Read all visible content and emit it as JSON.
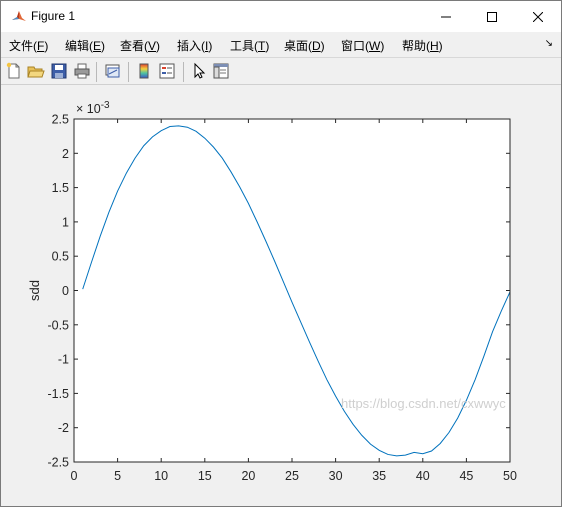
{
  "window": {
    "title": "Figure 1",
    "controls": {
      "minimize": "—",
      "maximize": "☐",
      "close": "✕"
    }
  },
  "menubar": {
    "items": [
      {
        "label": "文件(",
        "key": "F",
        "end": ")"
      },
      {
        "label": "编辑(",
        "key": "E",
        "end": ")"
      },
      {
        "label": "查看(",
        "key": "V",
        "end": ")"
      },
      {
        "label": "插入(",
        "key": "I",
        "end": ")"
      },
      {
        "label": "工具(",
        "key": "T",
        "end": ")"
      },
      {
        "label": "桌面(",
        "key": "D",
        "end": ")"
      },
      {
        "label": "窗口(",
        "key": "W",
        "end": ")"
      },
      {
        "label": "帮助(",
        "key": "H",
        "end": ")"
      }
    ],
    "overflow_icon": "↘"
  },
  "toolbar": {
    "icons": [
      "new-figure-icon",
      "open-icon",
      "save-icon",
      "print-icon",
      "link-plot-icon",
      "colorbar-icon",
      "legend-icon",
      "pointer-icon",
      "property-editor-icon"
    ]
  },
  "watermark": "https://blog.csdn.net/cxwwyc",
  "chart_data": {
    "type": "line",
    "xlabel": "",
    "ylabel": "sdd",
    "exponent_label": "× 10",
    "exponent_power": "-3",
    "xlim": [
      0,
      50
    ],
    "ylim": [
      -2.5,
      2.5
    ],
    "xticks": [
      0,
      5,
      10,
      15,
      20,
      25,
      30,
      35,
      40,
      45,
      50
    ],
    "xtick_labels": [
      "0",
      "5",
      "10",
      "15",
      "20",
      "25",
      "30",
      "35",
      "40",
      "45",
      "50"
    ],
    "yticks": [
      2.5,
      2,
      1.5,
      1,
      0.5,
      0,
      -0.5,
      -1,
      -1.5,
      -2,
      -2.5
    ],
    "ytick_labels": [
      "2.5",
      "2",
      "1.5",
      "1",
      "0.5",
      "0",
      "-0.5",
      "-1",
      "-1.5",
      "-2",
      "-2.5"
    ],
    "grid": false,
    "series": [
      {
        "color": "#0072bd",
        "x": [
          1,
          2,
          3,
          4,
          5,
          6,
          7,
          8,
          9,
          10,
          11,
          12,
          13,
          14,
          15,
          16,
          17,
          18,
          19,
          20,
          21,
          22,
          23,
          24,
          25,
          26,
          27,
          28,
          29,
          30,
          31,
          32,
          33,
          34,
          35,
          36,
          37,
          38,
          39,
          40,
          41,
          42,
          43,
          44,
          45,
          46,
          47,
          48,
          49,
          50
        ],
        "y": [
          0.02,
          0.41,
          0.79,
          1.14,
          1.45,
          1.71,
          1.93,
          2.11,
          2.24,
          2.33,
          2.39,
          2.4,
          2.38,
          2.32,
          2.22,
          2.09,
          1.93,
          1.73,
          1.51,
          1.27,
          1.0,
          0.72,
          0.43,
          0.13,
          -0.17,
          -0.46,
          -0.75,
          -1.03,
          -1.3,
          -1.54,
          -1.76,
          -1.95,
          -2.11,
          -2.24,
          -2.33,
          -2.39,
          -2.41,
          -2.4,
          -2.36,
          -2.38,
          -2.34,
          -2.23,
          -2.07,
          -1.86,
          -1.6,
          -1.3,
          -0.96,
          -0.6,
          -0.3,
          -0.02
        ]
      }
    ]
  }
}
